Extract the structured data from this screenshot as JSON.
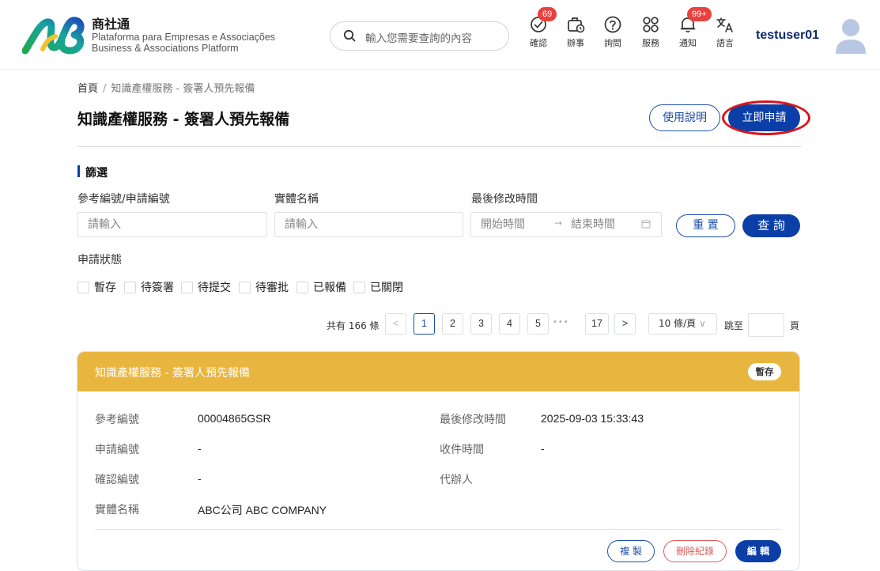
{
  "header": {
    "brand_title": "商社通",
    "brand_sub1": "Plataforma para Empresas e Associações",
    "brand_sub2": "Business & Associations Platform",
    "search_placeholder": "輸入您需要查詢的內容",
    "nav": [
      {
        "label": "確認",
        "badge": "69",
        "icon": "confirm-check-icon"
      },
      {
        "label": "辦事",
        "icon": "briefcase-clock-icon"
      },
      {
        "label": "詢問",
        "icon": "question-circle-icon"
      },
      {
        "label": "服務",
        "icon": "services-grid-icon"
      },
      {
        "label": "通知",
        "badge": "99+",
        "icon": "bell-icon"
      },
      {
        "label": "語言",
        "icon": "translate-icon"
      }
    ],
    "username": "testuser01"
  },
  "breadcrumb": {
    "home": "首頁",
    "sep": "/",
    "current": "知識產權服務 - 簽署人預先報備"
  },
  "page": {
    "title": "知識產權服務 - 簽署人預先報備",
    "help_button": "使用說明",
    "apply_button": "立即申請"
  },
  "filter": {
    "title": "篩選",
    "ref_label": "參考編號/申請編號",
    "ref_placeholder": "請輸入",
    "entity_label": "實體名稱",
    "entity_placeholder": "請輸入",
    "modified_label": "最後修改時間",
    "start_placeholder": "開始時間",
    "end_placeholder": "結束時間",
    "reset_button": "重 置",
    "query_button": "查 詢",
    "status_label": "申請狀態",
    "statuses": [
      "暫存",
      "待簽署",
      "待提交",
      "待審批",
      "已報備",
      "已關閉"
    ]
  },
  "pagination": {
    "total": "共有 166 條",
    "pages": [
      "1",
      "2",
      "3",
      "4",
      "5"
    ],
    "last_page": "17",
    "current_page": "1",
    "page_size": "10 條/頁",
    "jump_label": "跳至",
    "jump_suffix": "頁"
  },
  "card": {
    "title": "知識產權服務 - 簽署人預先報備",
    "status": "暫存",
    "fields": {
      "ref_no_key": "參考編號",
      "ref_no_val": "00004865GSR",
      "app_no_key": "申請編號",
      "app_no_val": "-",
      "confirm_no_key": "確認編號",
      "confirm_no_val": "-",
      "entity_key": "實體名稱",
      "entity_val": "ABC公司 ABC COMPANY",
      "modified_key": "最後修改時間",
      "modified_val": "2025-09-03 15:33:43",
      "received_key": "收件時間",
      "received_val": "-",
      "agent_key": "代辦人"
    },
    "copy_button": "複 製",
    "delete_button": "刪除紀錄",
    "edit_button": "編 輯"
  },
  "colors": {
    "primary": "#0b3fa7",
    "card_header": "#e8b53f",
    "badge": "#e8423f",
    "highlight_ring": "#d9141c"
  }
}
